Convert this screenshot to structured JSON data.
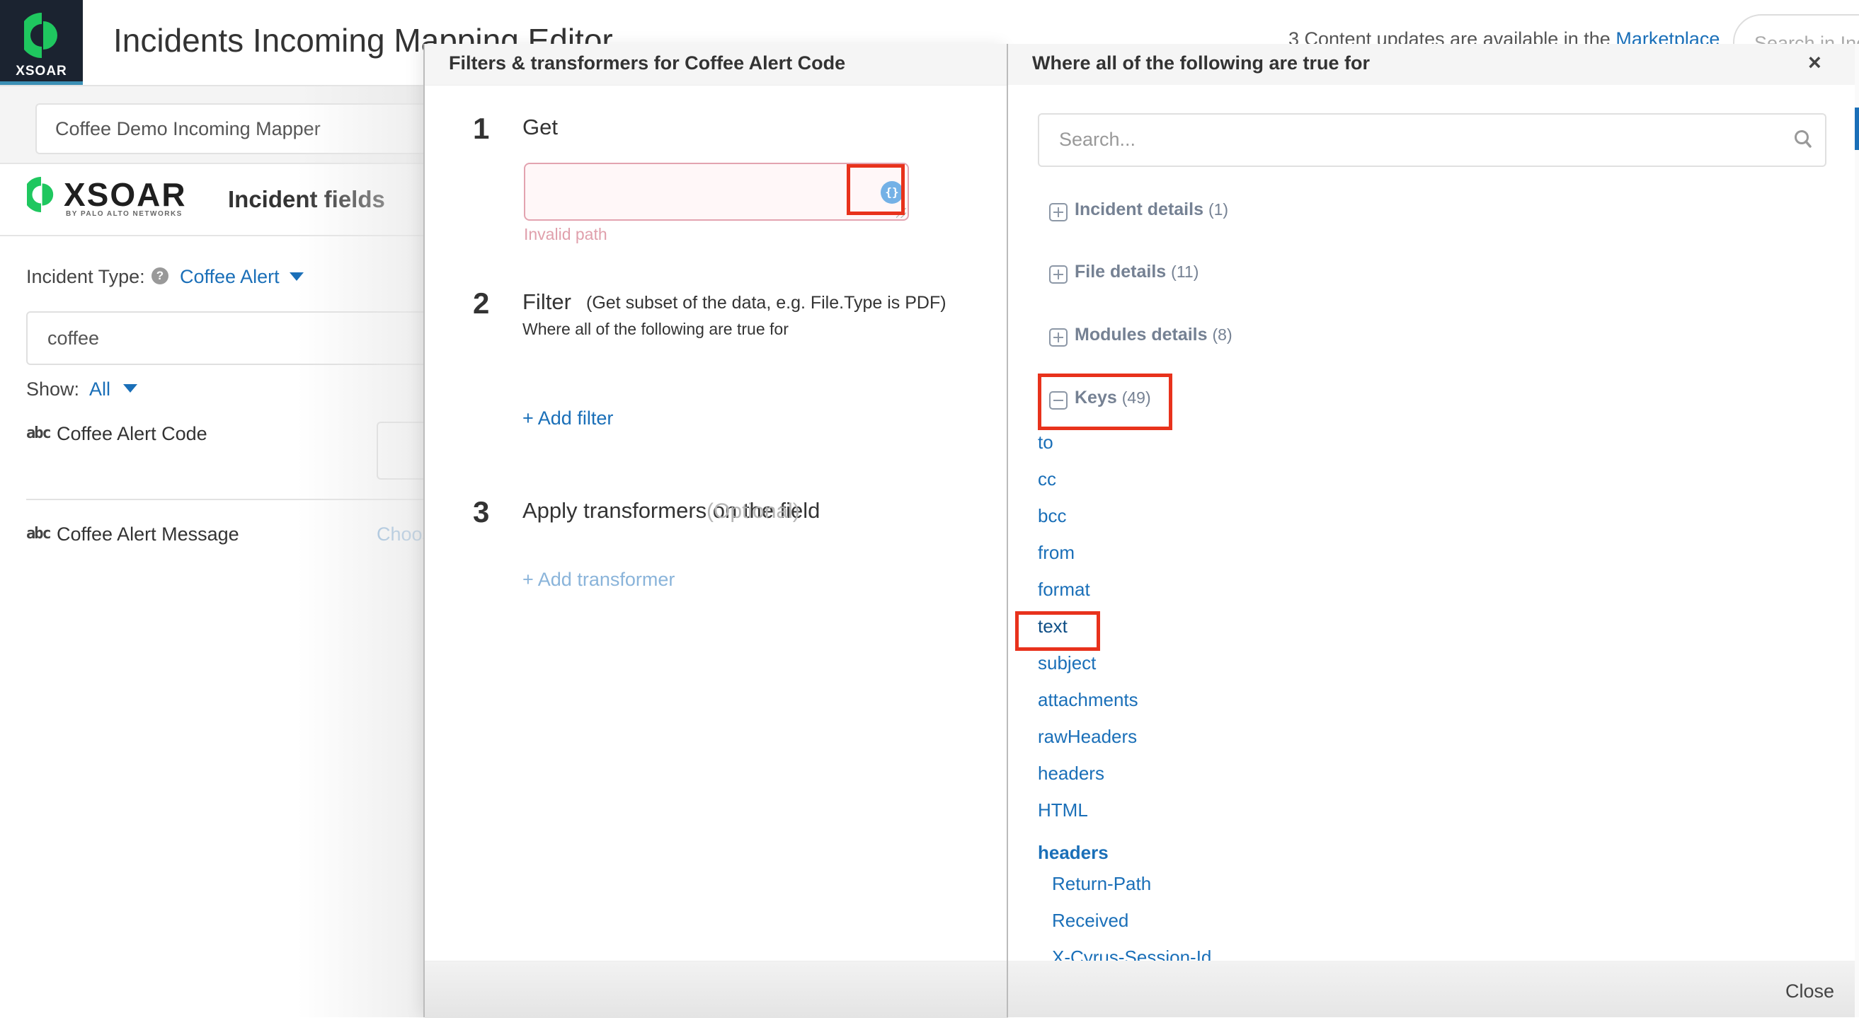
{
  "header": {
    "logo_text": "XSOAR",
    "title": "Incidents Incoming Mapping Editor",
    "updates_prefix": "3 Content updates are available in the ",
    "updates_link": "Marketplace",
    "global_search_placeholder": "Search in Inc"
  },
  "mapper": {
    "name": "Coffee Demo Incoming Mapper"
  },
  "brand": {
    "word": "XSOAR",
    "sub": "BY PALO ALTO NETWORKS",
    "section_title": "Incident fields"
  },
  "left_panel": {
    "incident_type_label": "Incident Type:",
    "incident_type_value": "Coffee Alert",
    "field_search_value": "coffee",
    "show_label": "Show:",
    "show_value": "All",
    "fields": [
      {
        "type_icon": "abc",
        "label": "Coffee Alert Code",
        "action": ""
      },
      {
        "type_icon": "abc",
        "label": "Coffee Alert Message",
        "action": "Choose"
      }
    ]
  },
  "filters_modal": {
    "title": "Filters & transformers for Coffee Alert Code",
    "steps": [
      {
        "number": "1",
        "title": "Get",
        "input_value": "",
        "error": "Invalid path",
        "icon": "{}"
      },
      {
        "number": "2",
        "title": "Filter",
        "hint": "(Get subset of the data, e.g. File.Type is PDF)",
        "subtitle": "Where all of the following are true for",
        "action": "+ Add filter"
      },
      {
        "number": "3",
        "title": "Apply transformers on the field",
        "optional": "(Optional)",
        "action": "+ Add transformer"
      }
    ]
  },
  "context_modal": {
    "title": "Where all of the following are true for",
    "close_icon": "×",
    "search_placeholder": "Search...",
    "groups": [
      {
        "label": "Incident details",
        "count": "(1)",
        "expanded": false
      },
      {
        "label": "File details",
        "count": "(11)",
        "expanded": false
      },
      {
        "label": "Modules details",
        "count": "(8)",
        "expanded": false
      },
      {
        "label": "Keys",
        "count": "(49)",
        "expanded": true
      }
    ],
    "keys": [
      "to",
      "cc",
      "bcc",
      "from",
      "format",
      "text",
      "subject",
      "attachments",
      "rawHeaders",
      "headers",
      "HTML"
    ],
    "selected_key": "text",
    "nested_group": {
      "label": "headers",
      "items": [
        "Return-Path",
        "Received",
        "X-Cyrus-Session-Id"
      ]
    },
    "close_button": "Close"
  },
  "colors": {
    "accent": "#1a6fb8",
    "highlight_box": "#e8321c",
    "error": "#e0a0ac",
    "logo_green": "#1fc75f",
    "logo_bg": "#1b2330"
  }
}
